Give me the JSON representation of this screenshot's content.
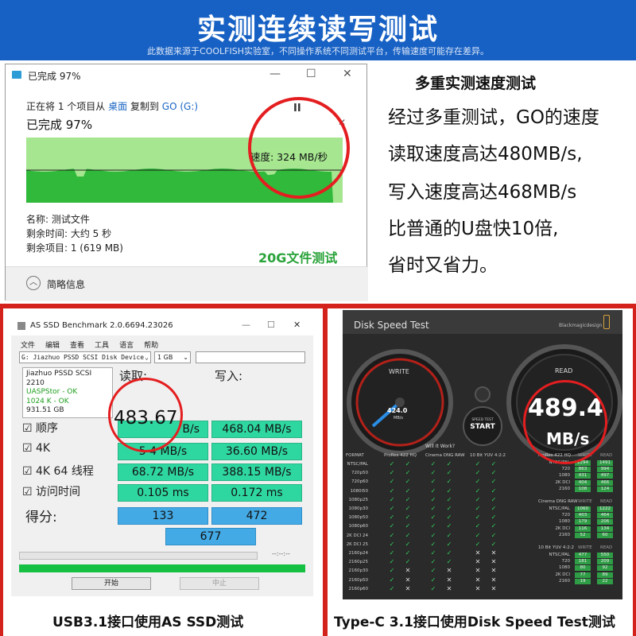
{
  "banner": {
    "title": "实测连续读写测试",
    "subtitle": "此数据来源于COOLFISH实验室，不同操作系统不同测试平台，传输速度可能存在差异。"
  },
  "copy_dialog": {
    "title": "已完成 97%",
    "win_min": "—",
    "win_max": "☐",
    "win_close": "✕",
    "line_prefix": "正在将 1 个项目从",
    "from": "桌面",
    "line_mid": "复制到",
    "to": "GO (G:)",
    "progress": "已完成 97%",
    "pause": "II",
    "close_x": "✕",
    "progress_fraction": 0.97,
    "speed": "速度: 324 MB/秒",
    "name": "名称: 测试文件",
    "time_left": "剩余时间: 大约 5 秒",
    "items_left": "剩余项目: 1 (619 MB)",
    "tag": "20G文件测试",
    "collapse": "简略信息"
  },
  "right_text": {
    "title": "多重实测速度测试",
    "lines": [
      "经过多重测试，GO的速度",
      "读取速度高达480MB/s,",
      "写入速度高达468MB/s",
      "比普通的U盘快10倍,",
      "省时又省力。"
    ]
  },
  "as_ssd": {
    "title": "AS SSD Benchmark 2.0.6694.23026",
    "menu": [
      "文件",
      "编辑",
      "查看",
      "工具",
      "语言",
      "帮助"
    ],
    "device": "G: Jiazhuo PSSD SCSI Disk Device",
    "size": "1 GB",
    "info": [
      "Jiazhuo PSSD SCSI",
      "2210",
      "UASPStor - OK",
      "1024 K - OK",
      "931.51 GB"
    ],
    "read_h": "读取:",
    "write_h": "写入:",
    "rows": [
      {
        "label": "顺序",
        "read": "483.67",
        "read_tail": "B/s",
        "write": "468.04 MB/s"
      },
      {
        "label": "4K",
        "read": "5  4  MB/s",
        "read_tail": "",
        "write": "36.60 MB/s"
      },
      {
        "label": "4K 64 线程",
        "read": "68.72 MB/s",
        "read_tail": "",
        "write": "388.15 MB/s"
      },
      {
        "label": "访问时间",
        "read": "0.105 ms",
        "read_tail": "",
        "write": "0.172 ms"
      }
    ],
    "score_label": "得分:",
    "score_read": "133",
    "score_write": "472",
    "score_total": "677",
    "time": "--:--:--",
    "start": "开始",
    "stop": "中止"
  },
  "disk_speed": {
    "title": "Disk Speed Test",
    "brand": "Blackmagicdesign",
    "write_label": "WRITE",
    "write_value": "424.0",
    "write_unit": "MB/s",
    "read_label": "READ",
    "read_value": "489.4",
    "read_unit": "MB/s",
    "start_small": "SPEED TEST",
    "start": "START",
    "will": "Will It Work?",
    "how": "How Fast?",
    "cols": [
      "FORMAT",
      "ProRes 422 HQ",
      "Cinema DNG RAW",
      "10 Bit YUV 4:2:2"
    ],
    "formats": [
      "NTSC/PAL",
      "720p50",
      "720p60",
      "1080i50",
      "1080p25",
      "1080p30",
      "1080p50",
      "1080p60",
      "2K DCI 24",
      "2K DCI 25",
      "2160p24",
      "2160p25",
      "2160p30",
      "2160p50",
      "2160p60"
    ],
    "fast_groups": [
      {
        "name": "ProRes 422 HQ",
        "rows": [
          [
            "NTSC/PAL",
            "1294",
            "1491"
          ],
          [
            "720",
            "863",
            "994"
          ],
          [
            "1080",
            "431",
            "497"
          ],
          [
            "2K DCI",
            "404",
            "466"
          ],
          [
            "2160",
            "108",
            "124"
          ]
        ]
      },
      {
        "name": "Cinema DNG RAW",
        "rows": [
          [
            "NTSC/PAL",
            "1060",
            "1222"
          ],
          [
            "720",
            "403",
            "464"
          ],
          [
            "1080",
            "179",
            "206"
          ],
          [
            "2K DCI",
            "116",
            "134"
          ],
          [
            "2160",
            "52",
            "60"
          ]
        ]
      },
      {
        "name": "10 Bit YUV 4:2:2",
        "rows": [
          [
            "NTSC/PAL",
            "477",
            "550"
          ],
          [
            "720",
            "181",
            "209"
          ],
          [
            "1080",
            "80",
            "92"
          ],
          [
            "2K DCI",
            "77",
            "89"
          ],
          [
            "2160",
            "19",
            "22"
          ]
        ]
      }
    ],
    "fast_cols": [
      "WRITE",
      "READ"
    ]
  },
  "captions": {
    "left": "USB3.1接口使用AS SSD测试",
    "right": "Type-C 3.1接口使用Disk Speed Test测试"
  },
  "colors": {
    "banner": "#1761c4",
    "red": "#d3211c",
    "green_cell": "#2fd7a0",
    "score_cell": "#44aae5"
  }
}
